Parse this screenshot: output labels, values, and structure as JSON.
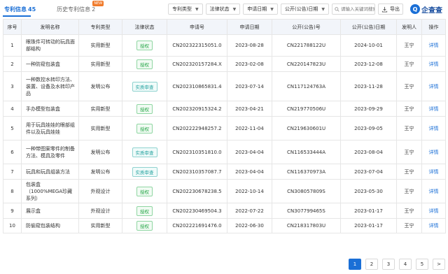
{
  "tabs": {
    "active_label": "专利信息",
    "active_count": "45",
    "history_label": "历史专利信息",
    "history_count": "2",
    "new_badge": "NEW"
  },
  "filters": [
    "专利类型",
    "法律状态",
    "申请日期",
    "公开(公告)日期"
  ],
  "search": {
    "placeholder": "请输入关键词搜索"
  },
  "export_label": "导出",
  "logo": {
    "mark": "Q",
    "text": "企查查"
  },
  "table": {
    "headers": [
      "序号",
      "发明名称",
      "专利类型",
      "法律状态",
      "申请号",
      "申请日期",
      "公开(公告)号",
      "公开(公告)日期",
      "发明人",
      "操作"
    ],
    "rows": [
      {
        "no": "1",
        "name": "眼珠件可转动的玩具面部结构",
        "type": "实用新型",
        "status": "授权",
        "status_color": "green",
        "app_no": "CN202322315051.0",
        "app_date": "2023-08-28",
        "pub_no": "CN221788122U",
        "pub_date": "2024-10-01",
        "inventor": "王宁",
        "action": "详情"
      },
      {
        "no": "2",
        "name": "一种防窥包装盒",
        "type": "实用新型",
        "status": "授权",
        "status_color": "green",
        "app_no": "CN202320157284.X",
        "app_date": "2023-02-08",
        "pub_no": "CN220147823U",
        "pub_date": "2023-12-08",
        "inventor": "王宁",
        "action": "详情"
      },
      {
        "no": "3",
        "name": "一种数控水转印方法、装置、设备及水转印产品",
        "type": "发明公布",
        "status": "实质审查",
        "status_color": "teal",
        "app_no": "CN202310865831.4",
        "app_date": "2023-07-14",
        "pub_no": "CN117124763A",
        "pub_date": "2023-11-28",
        "inventor": "王宁",
        "action": "详情"
      },
      {
        "no": "4",
        "name": "手办模型包装盒",
        "type": "实用新型",
        "status": "授权",
        "status_color": "green",
        "app_no": "CN202320915324.2",
        "app_date": "2023-04-21",
        "pub_no": "CN219770506U",
        "pub_date": "2023-09-29",
        "inventor": "王宁",
        "action": "详情"
      },
      {
        "no": "5",
        "name": "用于玩具娃娃的眼部组件以及玩具娃娃",
        "type": "实用新型",
        "status": "授权",
        "status_color": "green",
        "app_no": "CN202222948257.2",
        "app_date": "2022-11-04",
        "pub_no": "CN219630601U",
        "pub_date": "2023-09-05",
        "inventor": "王宁",
        "action": "详情"
      },
      {
        "no": "6",
        "name": "一种带图案零件的制备方法、模具及零件",
        "type": "发明公布",
        "status": "实质审查",
        "status_color": "teal",
        "app_no": "CN202310351810.0",
        "app_date": "2023-04-04",
        "pub_no": "CN116533444A",
        "pub_date": "2023-08-04",
        "inventor": "王宁",
        "action": "详情"
      },
      {
        "no": "7",
        "name": "玩具和玩具组装方法",
        "type": "发明公布",
        "status": "实质审查",
        "status_color": "teal",
        "app_no": "CN202310357087.7",
        "app_date": "2023-04-04",
        "pub_no": "CN116370973A",
        "pub_date": "2023-07-04",
        "inventor": "王宁",
        "action": "详情"
      },
      {
        "no": "8",
        "name": "包装盒（1000%MEGA珍藏系列）",
        "type": "外观设计",
        "status": "授权",
        "status_color": "green",
        "app_no": "CN202230678238.5",
        "app_date": "2022-10-14",
        "pub_no": "CN308057809S",
        "pub_date": "2023-05-30",
        "inventor": "王宁",
        "action": "详情"
      },
      {
        "no": "9",
        "name": "展示盒",
        "type": "外观设计",
        "status": "授权",
        "status_color": "green",
        "app_no": "CN202230469504.3",
        "app_date": "2022-07-22",
        "pub_no": "CN307799465S",
        "pub_date": "2023-01-17",
        "inventor": "王宁",
        "action": "详情"
      },
      {
        "no": "10",
        "name": "防偷窥包装结构",
        "type": "实用新型",
        "status": "授权",
        "status_color": "green",
        "app_no": "CN202221691476.0",
        "app_date": "2022-06-30",
        "pub_no": "CN218317803U",
        "pub_date": "2023-01-17",
        "inventor": "王宁",
        "action": "详情"
      }
    ]
  },
  "pagination": {
    "pages": [
      "1",
      "2",
      "3",
      "4",
      "5"
    ],
    "current": "1",
    "next": ">"
  },
  "colors": {
    "accent": "#1a6fd6",
    "granted": "#2aa84b",
    "examining": "#26a3a0"
  }
}
